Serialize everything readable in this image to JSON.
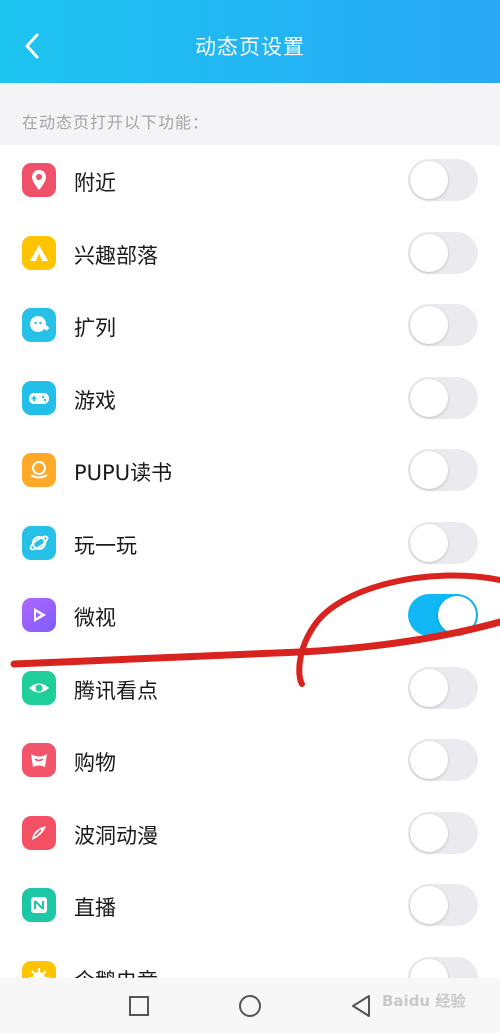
{
  "header": {
    "title": "动态页设置"
  },
  "section": {
    "label": "在动态页打开以下功能："
  },
  "colors": {
    "header_start": "#1ec4f0",
    "header_end": "#2aa8f6",
    "toggle_on": "#12b7f5",
    "toggle_off": "#ebebef",
    "annotation": "#d8231f"
  },
  "items": [
    {
      "label": "附近",
      "icon": "location-pin-icon",
      "enabled": false
    },
    {
      "label": "兴趣部落",
      "icon": "tent-icon",
      "enabled": false
    },
    {
      "label": "扩列",
      "icon": "add-friend-icon",
      "enabled": false
    },
    {
      "label": "游戏",
      "icon": "gamepad-icon",
      "enabled": false
    },
    {
      "label": "PUPU读书",
      "icon": "book-icon",
      "enabled": false
    },
    {
      "label": "玩一玩",
      "icon": "planet-icon",
      "enabled": false
    },
    {
      "label": "微视",
      "icon": "play-video-icon",
      "enabled": true
    },
    {
      "label": "腾讯看点",
      "icon": "eye-icon",
      "enabled": false
    },
    {
      "label": "购物",
      "icon": "shopping-icon",
      "enabled": false
    },
    {
      "label": "波洞动漫",
      "icon": "comic-icon",
      "enabled": false
    },
    {
      "label": "直播",
      "icon": "live-icon",
      "enabled": false
    },
    {
      "label": "企鹅电竞",
      "icon": "esports-icon",
      "enabled": false
    }
  ],
  "navbar": {
    "buttons": [
      "recent-apps-icon",
      "home-icon",
      "back-triangle-icon"
    ]
  },
  "watermark": {
    "text": "Baidu 经验"
  }
}
